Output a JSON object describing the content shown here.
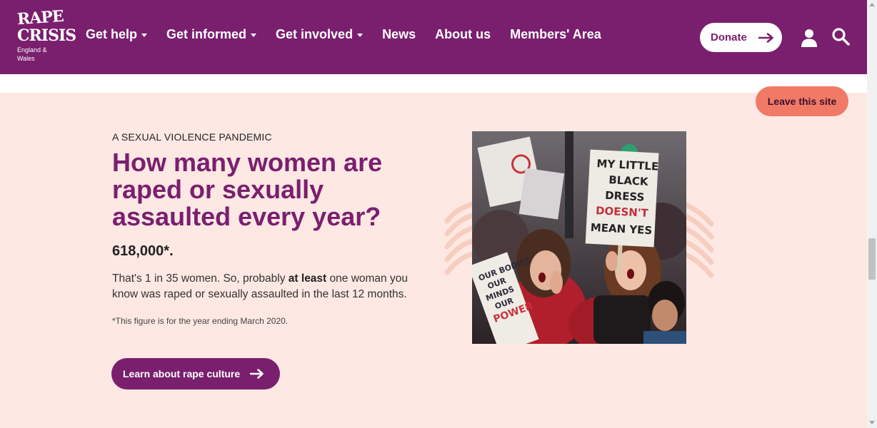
{
  "brand": {
    "logo_line1": "RAPE",
    "logo_line2": "CRISIS",
    "logo_sub": "England & Wales"
  },
  "nav": {
    "items": [
      {
        "label": "Get help",
        "dropdown": true
      },
      {
        "label": "Get informed",
        "dropdown": true
      },
      {
        "label": "Get involved",
        "dropdown": true
      },
      {
        "label": "News",
        "dropdown": false
      },
      {
        "label": "About us",
        "dropdown": false
      },
      {
        "label": "Members' Area",
        "dropdown": false
      }
    ],
    "donate_label": "Donate"
  },
  "leave_site_label": "Leave this site",
  "hero": {
    "eyebrow": "A SEXUAL VIOLENCE PANDEMIC",
    "headline": "How many women are raped or sexually assaulted every year?",
    "stat": "618,000*.",
    "para_before": "That's 1 in 35 women. So, probably ",
    "para_bold": "at least",
    "para_after": " one woman you know was raped or sexually assaulted in the last 12 months.",
    "footnote": "*This figure is for the year ending March 2020.",
    "cta_label": "Learn about rape culture"
  },
  "photo": {
    "sign_main": [
      "MY LITTLE",
      "BLACK",
      "DRESS",
      "DOESN'T",
      "MEAN YES"
    ],
    "sign_left": [
      "OUR BODIES",
      "OUR",
      "MINDS",
      "OUR",
      "POWER"
    ]
  },
  "colors": {
    "brand": "#7a1f6e",
    "accent": "#f17a66",
    "background": "#fde8e3"
  }
}
